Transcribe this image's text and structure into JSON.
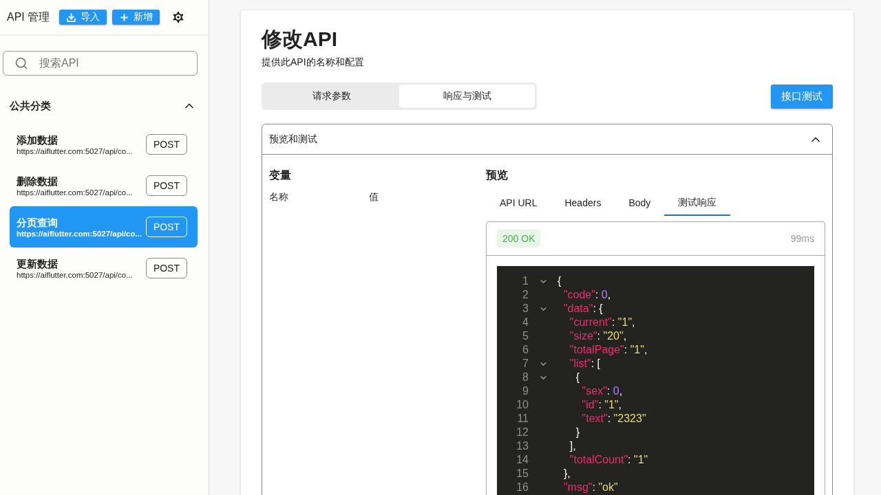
{
  "sidebar": {
    "title": "API 管理",
    "import_button": "导入",
    "add_button": "新增",
    "search": {
      "placeholder": "搜索API"
    },
    "group": {
      "title": "公共分类",
      "expanded": true,
      "items": [
        {
          "name": "添加数据",
          "url": "https://aiflutter.com:5027/api/co...",
          "method": "POST",
          "selected": false
        },
        {
          "name": "删除数据",
          "url": "https://aiflutter.com:5027/api/co...",
          "method": "POST",
          "selected": false
        },
        {
          "name": "分页查询",
          "url": "https://aiflutter.com:5027/api/co...",
          "method": "POST",
          "selected": true
        },
        {
          "name": "更新数据",
          "url": "https://aiflutter.com:5027/api/co...",
          "method": "POST",
          "selected": false
        }
      ]
    }
  },
  "main": {
    "title": "修改API",
    "subtitle": "提供此API的名称和配置",
    "tabs": [
      {
        "label": "请求参数",
        "selected": false
      },
      {
        "label": "响应与测试",
        "selected": true
      }
    ],
    "test_button": "接口测试",
    "panel": {
      "title": "预览和测试",
      "expanded": true,
      "variables": {
        "title": "变量",
        "columns": [
          "名称",
          "值"
        ]
      },
      "preview": {
        "title": "预览",
        "tabs": [
          {
            "label": "API URL",
            "selected": false
          },
          {
            "label": "Headers",
            "selected": false
          },
          {
            "label": "Body",
            "selected": false
          },
          {
            "label": "测试响应",
            "selected": true
          }
        ],
        "status": "200 OK",
        "time": "99ms",
        "code_lines": [
          {
            "number": "1",
            "foldable": true,
            "tokens": [
              {
                "kind": "punct",
                "text": "{"
              }
            ]
          },
          {
            "number": "2",
            "foldable": false,
            "tokens": [
              {
                "kind": "key",
                "text": "  \"code\""
              },
              {
                "kind": "punct",
                "text": ": "
              },
              {
                "kind": "number",
                "text": "0"
              },
              {
                "kind": "punct",
                "text": ","
              }
            ]
          },
          {
            "number": "3",
            "foldable": true,
            "tokens": [
              {
                "kind": "key",
                "text": "  \"data\""
              },
              {
                "kind": "punct",
                "text": ": {"
              }
            ]
          },
          {
            "number": "4",
            "foldable": false,
            "tokens": [
              {
                "kind": "key",
                "text": "    \"current\""
              },
              {
                "kind": "punct",
                "text": ": "
              },
              {
                "kind": "string",
                "text": "\"1\""
              },
              {
                "kind": "punct",
                "text": ","
              }
            ]
          },
          {
            "number": "5",
            "foldable": false,
            "tokens": [
              {
                "kind": "key",
                "text": "    \"size\""
              },
              {
                "kind": "punct",
                "text": ": "
              },
              {
                "kind": "string",
                "text": "\"20\""
              },
              {
                "kind": "punct",
                "text": ","
              }
            ]
          },
          {
            "number": "6",
            "foldable": false,
            "tokens": [
              {
                "kind": "key",
                "text": "    \"totalPage\""
              },
              {
                "kind": "punct",
                "text": ": "
              },
              {
                "kind": "string",
                "text": "\"1\""
              },
              {
                "kind": "punct",
                "text": ","
              }
            ]
          },
          {
            "number": "7",
            "foldable": true,
            "tokens": [
              {
                "kind": "key",
                "text": "    \"list\""
              },
              {
                "kind": "punct",
                "text": ": ["
              }
            ]
          },
          {
            "number": "8",
            "foldable": true,
            "tokens": [
              {
                "kind": "punct",
                "text": "      {"
              }
            ]
          },
          {
            "number": "9",
            "foldable": false,
            "tokens": [
              {
                "kind": "key",
                "text": "        \"sex\""
              },
              {
                "kind": "punct",
                "text": ": "
              },
              {
                "kind": "number",
                "text": "0"
              },
              {
                "kind": "punct",
                "text": ","
              }
            ]
          },
          {
            "number": "10",
            "foldable": false,
            "tokens": [
              {
                "kind": "key",
                "text": "        \"id\""
              },
              {
                "kind": "punct",
                "text": ": "
              },
              {
                "kind": "string",
                "text": "\"1\""
              },
              {
                "kind": "punct",
                "text": ","
              }
            ]
          },
          {
            "number": "11",
            "foldable": false,
            "tokens": [
              {
                "kind": "key",
                "text": "        \"text\""
              },
              {
                "kind": "punct",
                "text": ": "
              },
              {
                "kind": "string",
                "text": "\"2323\""
              }
            ]
          },
          {
            "number": "12",
            "foldable": false,
            "tokens": [
              {
                "kind": "punct",
                "text": "      }"
              }
            ]
          },
          {
            "number": "13",
            "foldable": false,
            "tokens": [
              {
                "kind": "punct",
                "text": "    ],"
              }
            ]
          },
          {
            "number": "14",
            "foldable": false,
            "tokens": [
              {
                "kind": "key",
                "text": "    \"totalCount\""
              },
              {
                "kind": "punct",
                "text": ": "
              },
              {
                "kind": "string",
                "text": "\"1\""
              }
            ]
          },
          {
            "number": "15",
            "foldable": false,
            "tokens": [
              {
                "kind": "punct",
                "text": "  },"
              }
            ]
          },
          {
            "number": "16",
            "foldable": false,
            "tokens": [
              {
                "kind": "key",
                "text": "  \"msg\""
              },
              {
                "kind": "punct",
                "text": ": "
              },
              {
                "kind": "string",
                "text": "\"ok\""
              }
            ]
          }
        ]
      }
    }
  }
}
